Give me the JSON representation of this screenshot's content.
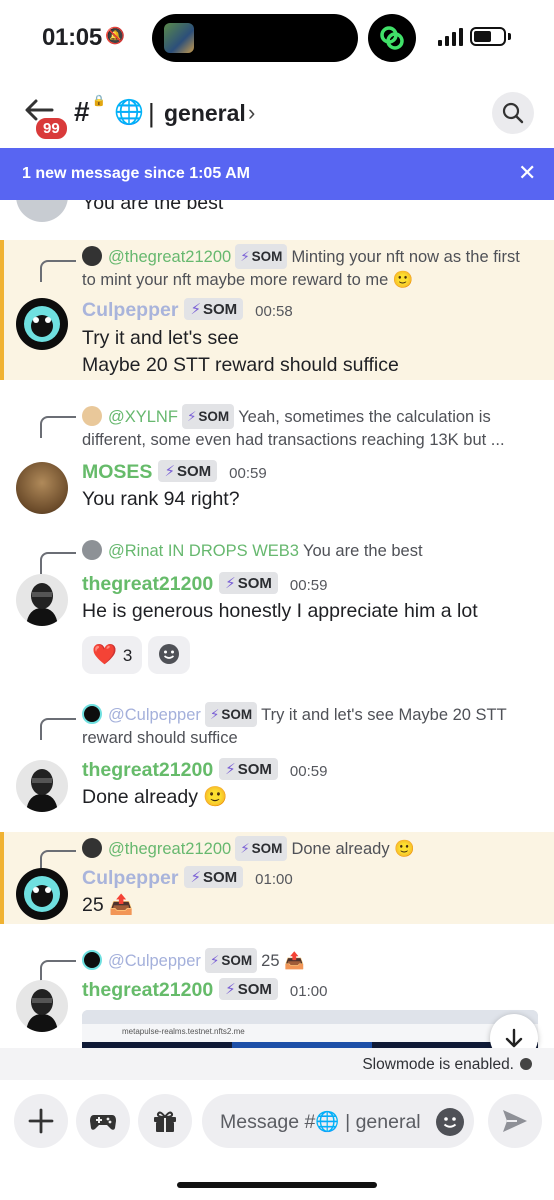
{
  "status_bar": {
    "time": "01:05",
    "battery_level": 0.6
  },
  "header": {
    "back_badge": "99",
    "channel_name": "general",
    "separator": "|",
    "chevron": "›"
  },
  "banner": {
    "text": "1 new message since 1:05 AM",
    "close": "✕"
  },
  "partial_message": {
    "text": "You are the best"
  },
  "messages": [
    {
      "reply_user": "@thegreat21200",
      "reply_tag": "SOM",
      "reply_text": "Minting your nft now as the first to mint your nft maybe more reward to me 🙂",
      "author": "Culpepper",
      "tag": "SOM",
      "time": "00:58",
      "lines": [
        "Try it and let's see",
        "Maybe 20 STT reward should suffice"
      ]
    },
    {
      "reply_user": "@XYLNF",
      "reply_tag": "SOM",
      "reply_text": "Yeah, sometimes the calculation is different, some even had transactions reaching 13K but ...",
      "author": "MOSES",
      "tag": "SOM",
      "time": "00:59",
      "lines": [
        "You rank 94 right?"
      ]
    },
    {
      "reply_user": "@Rinat IN DROPS WEB3",
      "reply_tag": "",
      "reply_text": "You are the best",
      "author": "thegreat21200",
      "tag": "SOM",
      "time": "00:59",
      "lines": [
        "He is generous honestly I appreciate him a lot"
      ],
      "reaction_heart": "❤️",
      "reaction_count": "3"
    },
    {
      "reply_user": "@Culpepper",
      "reply_tag": "SOM",
      "reply_text": "Try it and let's see  Maybe 20 STT reward should suffice",
      "author": "thegreat21200",
      "tag": "SOM",
      "time": "00:59",
      "lines": [
        "Done already 🙂"
      ]
    },
    {
      "reply_user": "@thegreat21200",
      "reply_tag": "SOM",
      "reply_text": "Done already 🙂",
      "author": "Culpepper",
      "tag": "SOM",
      "time": "01:00",
      "lines": [
        "25 📤"
      ]
    },
    {
      "reply_user": "@Culpepper",
      "reply_tag": "SOM",
      "reply_text": "25 📤",
      "author": "thegreat21200",
      "tag": "SOM",
      "time": "01:00",
      "embed_url": "metapulse-realms.testnet.nfts2.me"
    }
  ],
  "slowmode": "Slowmode is enabled.",
  "composer": {
    "placeholder": "Message #🌐 | general"
  },
  "colors": {
    "accent": "#5865f2",
    "mention_bg": "#fbf4e3",
    "mention_bar": "#f0b232",
    "name_green": "#66bb6a",
    "name_culpepper": "#a9b4db"
  },
  "icons": [
    "bell-slash-icon",
    "back-arrow-icon",
    "lock-icon",
    "globe-icon",
    "search-icon",
    "close-icon",
    "bolt-icon",
    "add-reaction-icon",
    "chevron-down-icon",
    "plus-icon",
    "gamepad-icon",
    "gift-icon",
    "emoji-icon",
    "send-icon"
  ]
}
